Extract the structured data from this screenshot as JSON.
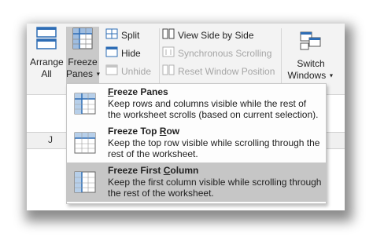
{
  "ribbon": {
    "arrange_all": {
      "line1": "Arrange",
      "line2": "All"
    },
    "freeze_panes": {
      "line1": "Freeze",
      "line2": "Panes"
    },
    "split": "Split",
    "hide": "Hide",
    "unhide": "Unhide",
    "view_side_by_side": "View Side by Side",
    "synchronous_scrolling": "Synchronous Scrolling",
    "reset_window_position": "Reset Window Position",
    "switch_windows": {
      "line1": "Switch",
      "line2": "Windows"
    }
  },
  "sheet": {
    "column_label": "J"
  },
  "menu": {
    "items": [
      {
        "title_pre": "",
        "title_u": "F",
        "title_post": "reeze Panes",
        "description": "Keep rows and columns visible while the rest of the worksheet scrolls (based on current selection)."
      },
      {
        "title_pre": "Freeze Top ",
        "title_u": "R",
        "title_post": "ow",
        "description": "Keep the top row visible while scrolling through the rest of the worksheet."
      },
      {
        "title_pre": "Freeze First ",
        "title_u": "C",
        "title_post": "olumn",
        "description": "Keep the first column visible while scrolling through the rest of the worksheet."
      }
    ]
  },
  "colors": {
    "selected_bg": "#c6c6c6",
    "ribbon_bg": "#f3f3f3",
    "icon_blue": "#2e6db5"
  }
}
